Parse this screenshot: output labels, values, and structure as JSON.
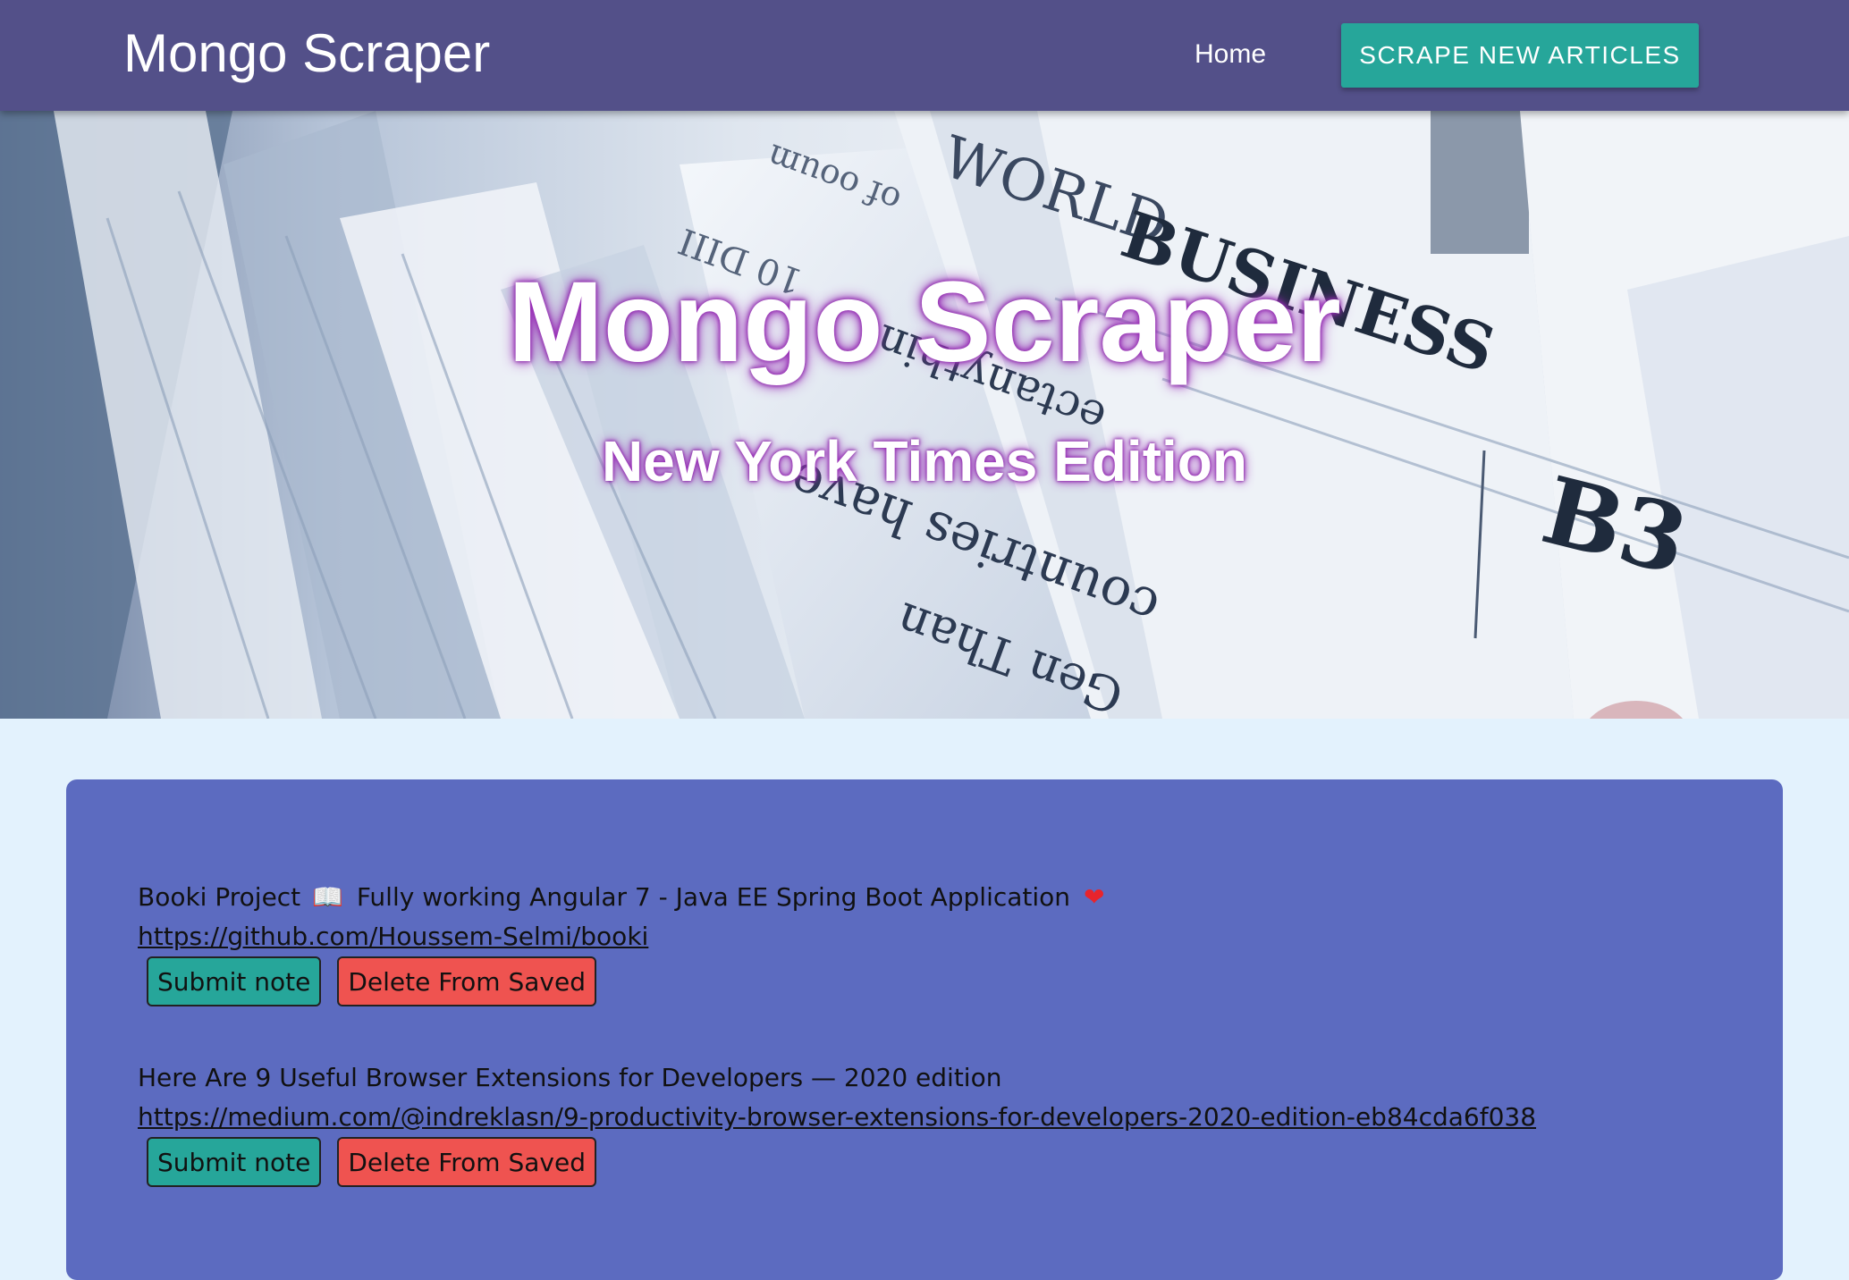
{
  "navbar": {
    "brand": "Mongo Scraper",
    "home_label": "Home",
    "scrape_label": "SCRAPE NEW ARTICLES"
  },
  "hero": {
    "title": "Mongo Scraper",
    "subtitle": "New York Times Edition",
    "background_text": [
      "WORLD BUSINESS",
      "B3",
      "countries have",
      "Gen Than"
    ]
  },
  "articles": [
    {
      "title": "Booki Project",
      "title_rest": "Fully working Angular 7 - Java EE Spring Boot Application",
      "book_emoji": "📖",
      "heart_emoji": "❤",
      "link": "https://github.com/Houssem-Selmi/booki",
      "note_label": "Submit note",
      "delete_label": "Delete From Saved"
    },
    {
      "title": "Here Are 9 Useful Browser Extensions for Developers — 2020 edition",
      "link": "https://medium.com/@indreklasn/9-productivity-browser-extensions-for-developers-2020-edition-eb84cda6f038",
      "note_label": "Submit note",
      "delete_label": "Delete From Saved"
    }
  ],
  "colors": {
    "navbar": "#535089",
    "accent_button": "#26a69a",
    "card": "#5c6bc0",
    "delete_button": "#ef5350",
    "page_background": "#e3f2fd"
  }
}
